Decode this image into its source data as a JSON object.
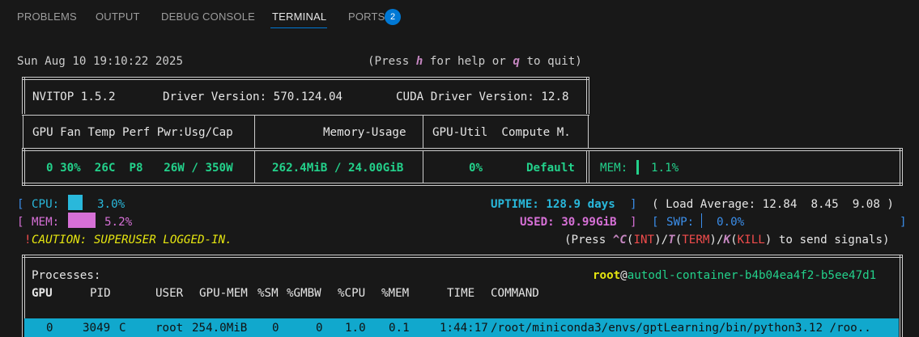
{
  "panel_tabs": [
    {
      "label": "PROBLEMS"
    },
    {
      "label": "OUTPUT"
    },
    {
      "label": "DEBUG CONSOLE"
    },
    {
      "label": "TERMINAL"
    },
    {
      "label": "PORTS"
    }
  ],
  "ports_badge": "2",
  "header": {
    "datetime": "Sun Aug 10 19:10:22 2025",
    "help_prefix": "(Press ",
    "help_key": "h",
    "help_mid": " for help or ",
    "quit_key": "q",
    "help_suffix": " to quit)"
  },
  "gpu_table": {
    "nvitop": "NVITOP 1.5.2",
    "driver": "Driver Version: 570.124.04",
    "cuda": "CUDA Driver Version: 12.8",
    "col_left": "GPU Fan Temp Perf Pwr:Usg/Cap",
    "col_mid": "Memory-Usage",
    "col_right": "GPU-Util  Compute M.",
    "row_left": "0 30%  26C  P8   26W / 350W",
    "row_mid": "262.4MiB / 24.00GiB",
    "row_util": "0%",
    "row_compute": "Default",
    "mem_label": "MEM:",
    "mem_value": "1.1%",
    "mem_fraction": 0.011
  },
  "host": {
    "cpu_label": "CPU:",
    "cpu_value": "3.0%",
    "mem_label": "MEM:",
    "mem_value": "5.2%",
    "uptime": "UPTIME: 128.9 days",
    "load": "( Load Average: 12.84  8.45  9.08 )",
    "used": "USED: 30.99GiB",
    "swp_label": "SWP:",
    "swp_value": "0.0%",
    "caution_mark": "!",
    "caution": "CAUTION: SUPERUSER LOGGED-IN.",
    "signals": {
      "prefix": "(Press ",
      "c_key": "^C",
      "int": "INT",
      "t_key": "T",
      "term": "TERM",
      "k_key": "K",
      "kill": "KILL",
      "suffix": " to send signals)"
    }
  },
  "processes": {
    "title": "Processes:",
    "user": "root",
    "at": "@",
    "host": "autodl-container-b4b04ea4f2-b5ee47d1",
    "columns": [
      "GPU",
      "PID",
      "USER",
      "GPU-MEM",
      "%SM",
      "%GMBW",
      "%CPU",
      "%MEM",
      "TIME",
      "COMMAND"
    ],
    "rows": [
      {
        "gpu": "0",
        "pid": "3049",
        "type": "C",
        "user": "root",
        "gpu_mem": "254.0MiB",
        "sm": "0",
        "gmbw": "0",
        "cpu": "1.0",
        "mem": "0.1",
        "time": "1:44:17",
        "command": "/root/miniconda3/envs/gptLearning/bin/python3.12 /roo.."
      }
    ]
  },
  "colors": {
    "background": "#181818",
    "accent": "#0078d4",
    "green": "#23d18b",
    "cyan": "#29b8db",
    "magenta": "#d670d6",
    "yellow": "#e5e510",
    "red": "#f14c4c"
  }
}
